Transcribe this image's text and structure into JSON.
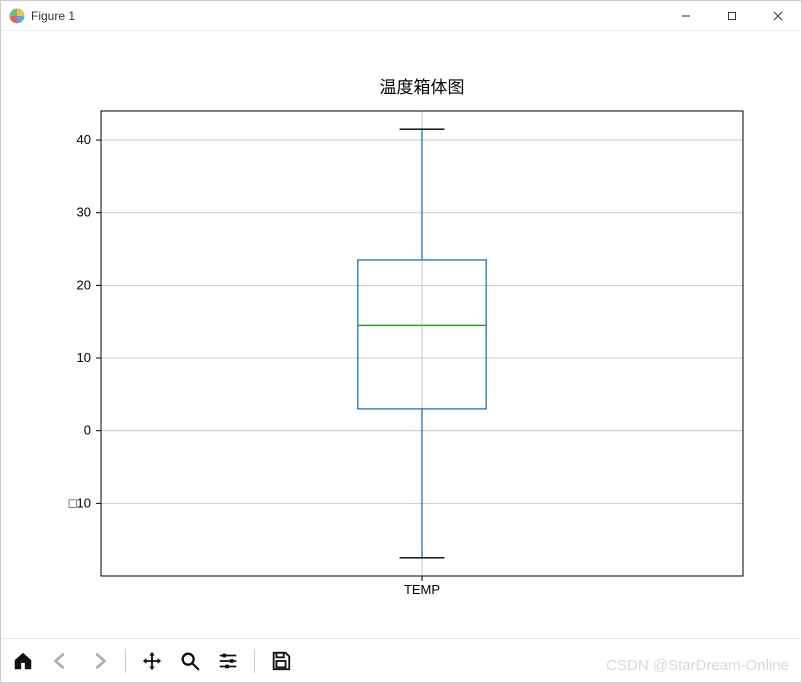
{
  "window": {
    "title": "Figure 1"
  },
  "toolbar": {
    "home": "Home",
    "back": "Back",
    "forward": "Forward",
    "pan": "Pan",
    "zoom": "Zoom",
    "config": "Configure subplots",
    "save": "Save"
  },
  "watermark": "CSDN @StarDream-Online",
  "colors": {
    "box_edge": "#1f77b4",
    "median": "#2ca02c",
    "whisker": "#1f77b4",
    "cap": "#000000",
    "grid": "#bfbfbf"
  },
  "chart_data": {
    "type": "boxplot",
    "title": "温度箱体图",
    "xlabel": "",
    "ylabel": "",
    "categories": [
      "TEMP"
    ],
    "series": [
      {
        "name": "TEMP",
        "whisker_low": -17.5,
        "q1": 3,
        "median": 14.5,
        "q3": 23.5,
        "whisker_high": 41.5,
        "outliers": []
      }
    ],
    "yticks": [
      -10,
      0,
      10,
      20,
      30,
      40
    ],
    "ytick_labels": [
      "□10",
      "0",
      "10",
      "20",
      "30",
      "40"
    ],
    "ylim": [
      -20,
      44
    ],
    "grid": true,
    "legend": false
  }
}
